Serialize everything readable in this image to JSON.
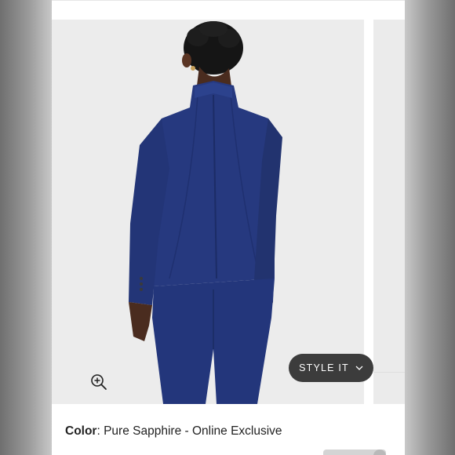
{
  "product": {
    "style_it_label": "STYLE IT",
    "color_label": "Color",
    "color_separator": ": ",
    "color_value": "Pure Sapphire",
    "color_suffix": " - Online Exclusive"
  },
  "colors": {
    "jacket": "#24387d",
    "background": "#ececec",
    "button": "#3c3c3c"
  },
  "icons": {
    "zoom": "zoom-in-magnifier-icon",
    "chevron": "chevron-down-icon"
  }
}
